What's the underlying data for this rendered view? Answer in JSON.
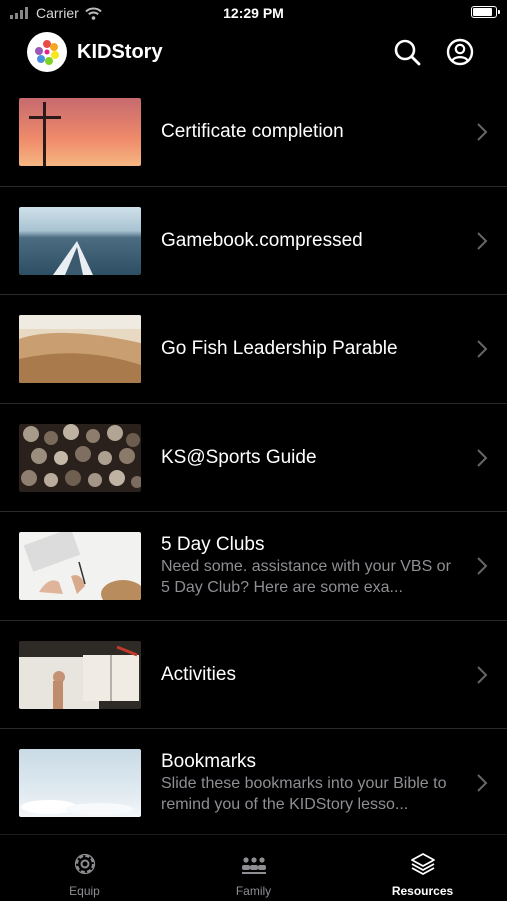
{
  "status_bar": {
    "carrier": "Carrier",
    "time": "12:29 PM"
  },
  "header": {
    "app_title": "KIDStory",
    "logo_icon": "flower-logo-icon",
    "search_icon": "search-icon",
    "account_icon": "account-icon"
  },
  "resources": [
    {
      "title": "Certificate completion",
      "subtitle": "",
      "thumbnail": "cross-sunset-image"
    },
    {
      "title": "Gamebook.compressed",
      "subtitle": "",
      "thumbnail": "kayak-lake-image"
    },
    {
      "title": "Go Fish Leadership Parable",
      "subtitle": "",
      "thumbnail": "desert-dunes-image"
    },
    {
      "title": "KS@Sports Guide",
      "subtitle": "",
      "thumbnail": "log-ends-image"
    },
    {
      "title": "5 Day Clubs",
      "subtitle": "Need some. assistance with your VBS or 5 Day Club?  Here are some exa...",
      "thumbnail": "desk-writing-image"
    },
    {
      "title": "Activities",
      "subtitle": "",
      "thumbnail": "reading-book-image"
    },
    {
      "title": "Bookmarks",
      "subtitle": "Slide these bookmarks into your Bible to remind you of the KIDStory lesso...",
      "thumbnail": "clouds-sky-image"
    }
  ],
  "tabs": [
    {
      "label": "Equip",
      "icon": "gear-icon",
      "active": false
    },
    {
      "label": "Family",
      "icon": "people-group-icon",
      "active": false
    },
    {
      "label": "Resources",
      "icon": "layers-icon",
      "active": true
    }
  ],
  "colors": {
    "background": "#000000",
    "text_primary": "#ffffff",
    "text_secondary": "#8e8e93",
    "separator": "#2a2a2a"
  }
}
